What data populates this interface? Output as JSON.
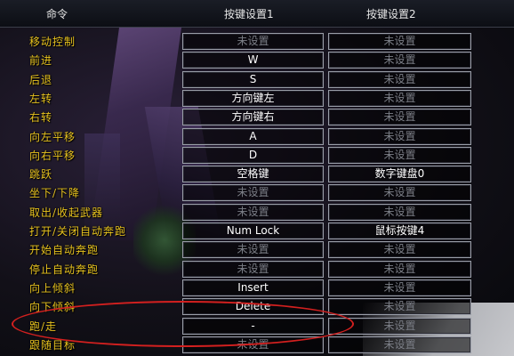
{
  "header": {
    "command": "命令",
    "keybind1": "按键设置1",
    "keybind2": "按键设置2"
  },
  "rows": [
    {
      "label": "移动控制",
      "k1": "未设置",
      "k2": "未设置"
    },
    {
      "label": "前进",
      "k1": "W",
      "k2": "未设置"
    },
    {
      "label": "后退",
      "k1": "S",
      "k2": "未设置"
    },
    {
      "label": "左转",
      "k1": "方向键左",
      "k2": "未设置"
    },
    {
      "label": "右转",
      "k1": "方向键右",
      "k2": "未设置"
    },
    {
      "label": "向左平移",
      "k1": "A",
      "k2": "未设置"
    },
    {
      "label": "向右平移",
      "k1": "D",
      "k2": "未设置"
    },
    {
      "label": "跳跃",
      "k1": "空格键",
      "k2": "数字键盘0"
    },
    {
      "label": "坐下/下降",
      "k1": "未设置",
      "k2": "未设置"
    },
    {
      "label": "取出/收起武器",
      "k1": "未设置",
      "k2": "未设置"
    },
    {
      "label": "打开/关闭自动奔跑",
      "k1": "Num Lock",
      "k2": "鼠标按键4"
    },
    {
      "label": "开始自动奔跑",
      "k1": "未设置",
      "k2": "未设置"
    },
    {
      "label": "停止自动奔跑",
      "k1": "未设置",
      "k2": "未设置"
    },
    {
      "label": "向上倾斜",
      "k1": "Insert",
      "k2": "未设置"
    },
    {
      "label": "向下倾斜",
      "k1": "Delete",
      "k2": "未设置"
    },
    {
      "label": "跑/走",
      "k1": "-",
      "k2": "未设置"
    },
    {
      "label": "跟随目标",
      "k1": "未设置",
      "k2": "未设置"
    }
  ],
  "colors": {
    "label_gold": "#e7c21f",
    "highlight_red": "#d3201f"
  },
  "empty_value": "未设置"
}
